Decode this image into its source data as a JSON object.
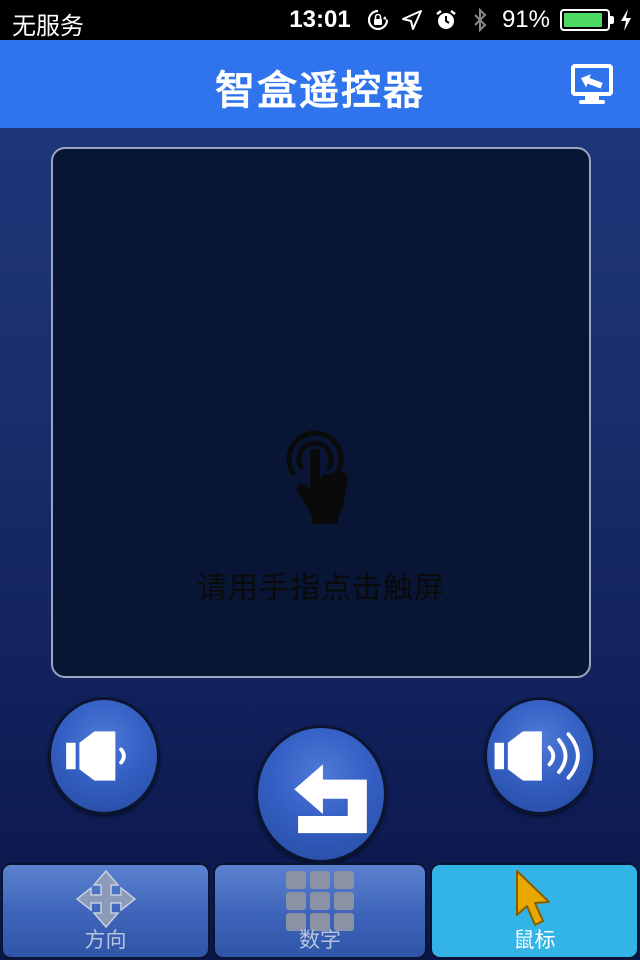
{
  "status_bar": {
    "carrier": "无服务",
    "time": "13:01",
    "battery_percent": "91%",
    "battery_level": 0.91,
    "icons": [
      "rotation-lock-icon",
      "location-arrow-icon",
      "alarm-icon",
      "bluetooth-icon",
      "battery-icon",
      "charging-bolt-icon"
    ]
  },
  "nav": {
    "title": "智盒遥控器",
    "cast_icon": "screen-cast-icon"
  },
  "touchpad": {
    "hint": "请用手指点击触屏",
    "icon": "touch-finger-icon"
  },
  "controls": {
    "volume_down_icon": "volume-down-icon",
    "volume_up_icon": "volume-up-icon",
    "back_icon": "back-arrow-icon"
  },
  "tabs": [
    {
      "label": "方向",
      "icon": "direction-pad-icon",
      "active": false
    },
    {
      "label": "数字",
      "icon": "number-grid-icon",
      "active": false
    },
    {
      "label": "鼠标",
      "icon": "mouse-pointer-icon",
      "active": true
    }
  ],
  "colors": {
    "nav_bar": "#2f74ec",
    "active_tab": "#33b4e6",
    "battery_fill": "#4cd964",
    "background": "#1a2f6c"
  }
}
